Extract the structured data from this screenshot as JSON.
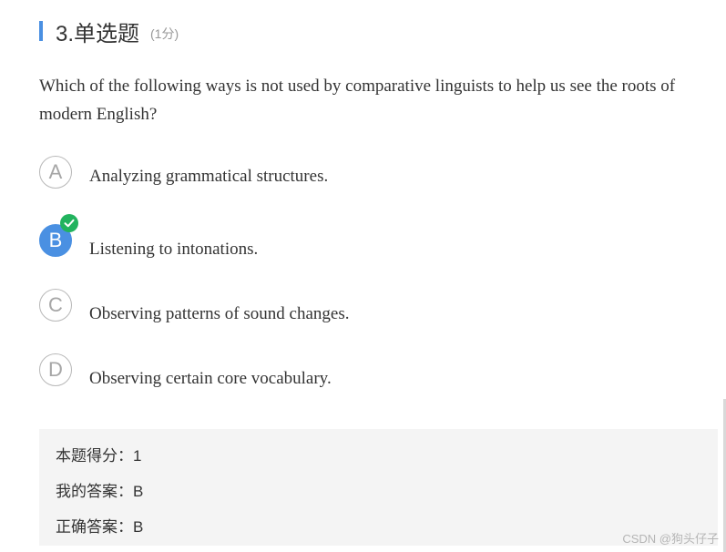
{
  "header": {
    "title": "3.单选题",
    "score": "(1分)",
    "accent_color": "#4a90e2"
  },
  "question": {
    "text": "Which of the following ways is not used by comparative linguists to help us see the roots of modern English?"
  },
  "options": [
    {
      "letter": "A",
      "text": "Analyzing grammatical structures.",
      "selected": false
    },
    {
      "letter": "B",
      "text": "Listening to intonations.",
      "selected": true,
      "correct_mark": "check-icon"
    },
    {
      "letter": "C",
      "text": "Observing patterns of sound changes.",
      "selected": false
    },
    {
      "letter": "D",
      "text": "Observing certain core vocabulary.",
      "selected": false
    }
  ],
  "result": {
    "score_line": "本题得分：1",
    "my_answer_line": "我的答案：B",
    "correct_answer_line": "正确答案：B"
  },
  "watermark": "CSDN @狗头仔子",
  "colors": {
    "selected": "#4a90e2",
    "correct_badge": "#22b35e",
    "panel_bg": "#f4f4f4"
  }
}
